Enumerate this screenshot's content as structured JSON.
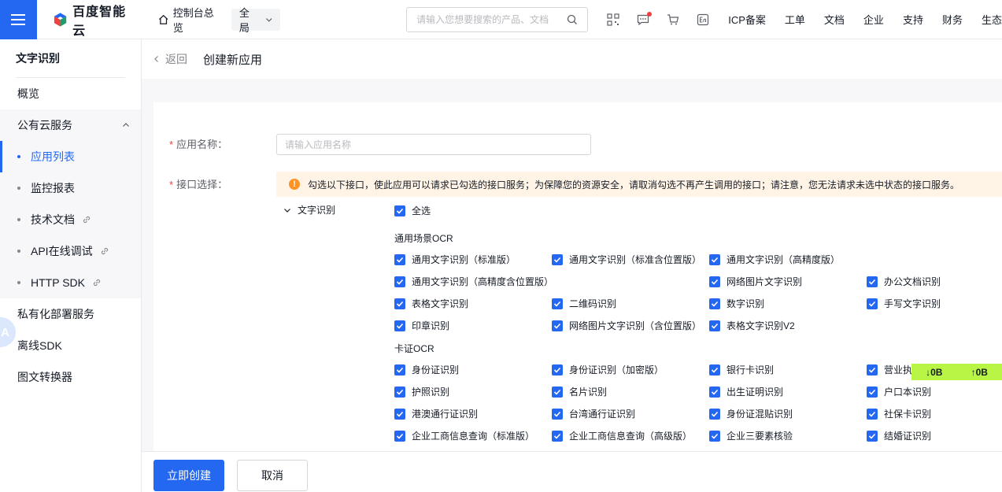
{
  "topbar": {
    "brand": "百度智能云",
    "console": "控制台总览",
    "scope": "全局",
    "search_placeholder": "请输入您想要搜索的产品、文档",
    "links": [
      "ICP备案",
      "工单",
      "文档",
      "企业",
      "支持",
      "财务",
      "生态"
    ]
  },
  "sidebar": {
    "title": "文字识别",
    "overview": "概览",
    "public_group": "公有云服务",
    "sub_items": [
      {
        "label": "应用列表",
        "link": false,
        "active": true
      },
      {
        "label": "监控报表",
        "link": false,
        "active": false
      },
      {
        "label": "技术文档",
        "link": true,
        "active": false
      },
      {
        "label": "API在线调试",
        "link": true,
        "active": false
      },
      {
        "label": "HTTP SDK",
        "link": true,
        "active": false
      }
    ],
    "private": "私有化部署服务",
    "offline_sdk": "离线SDK",
    "converter": "图文转换器",
    "avatar_letter": "A"
  },
  "header": {
    "back": "返回",
    "title": "创建新应用"
  },
  "form": {
    "name_label": "应用名称：",
    "name_placeholder": "请输入应用名称",
    "api_label": "接口选择：",
    "notice": "勾选以下接口，使此应用可以请求已勾选的接口服务；为保障您的资源安全，请取消勾选不再产生调用的接口；请注意，您无法请求未选中状态的接口服务。",
    "tree_node": "文字识别",
    "select_all": "全选",
    "section_general": "通用场景OCR",
    "section_card": "卡证OCR",
    "general_items": [
      "通用文字识别（标准版）",
      "通用文字识别（标准含位置版）",
      "通用文字识别（高精度版）",
      "通用文字识别（高精度含位置版）",
      "网络图片文字识别",
      "办公文档识别",
      "表格文字识别",
      "二维码识别",
      "数字识别",
      "手写文字识别",
      "印章识别",
      "网络图片文字识别（含位置版）",
      "表格文字识别V2"
    ],
    "card_items": [
      "身份证识别",
      "身份证识别（加密版）",
      "银行卡识别",
      "营业执",
      "护照识别",
      "名片识别",
      "出生证明识别",
      "户口本识别",
      "港澳通行证识别",
      "台湾通行证识别",
      "身份证混贴识别",
      "社保卡识别",
      "企业工商信息查询（标准版）",
      "企业工商信息查询（高级版）",
      "企业三要素核验",
      "结婚证识别"
    ]
  },
  "net_badge": {
    "down": "↓0B",
    "up": "↑0B"
  },
  "footer": {
    "create": "立即创建",
    "cancel": "取消"
  },
  "colors": {
    "accent": "#2468f2",
    "warning": "#ff9326",
    "notice_bg": "#fff4e6",
    "badge": "#b8f545"
  }
}
